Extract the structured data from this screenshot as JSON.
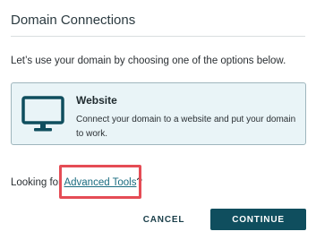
{
  "dialog": {
    "title": "Domain Connections",
    "intro": "Let’s use your domain by choosing one of the options below."
  },
  "option": {
    "icon": "monitor-icon",
    "title": "Website",
    "description": "Connect your domain to a website and put your domain to work."
  },
  "footer": {
    "looking_prefix": "Looking for ",
    "advanced_link": "Advanced Tools",
    "looking_suffix": "?"
  },
  "buttons": {
    "cancel": "CANCEL",
    "continue": "CONTINUE"
  },
  "colors": {
    "accent": "#0f4e5e",
    "link": "#1a6c80",
    "card_bg": "#e9f4f7",
    "highlight": "#e54c55"
  }
}
